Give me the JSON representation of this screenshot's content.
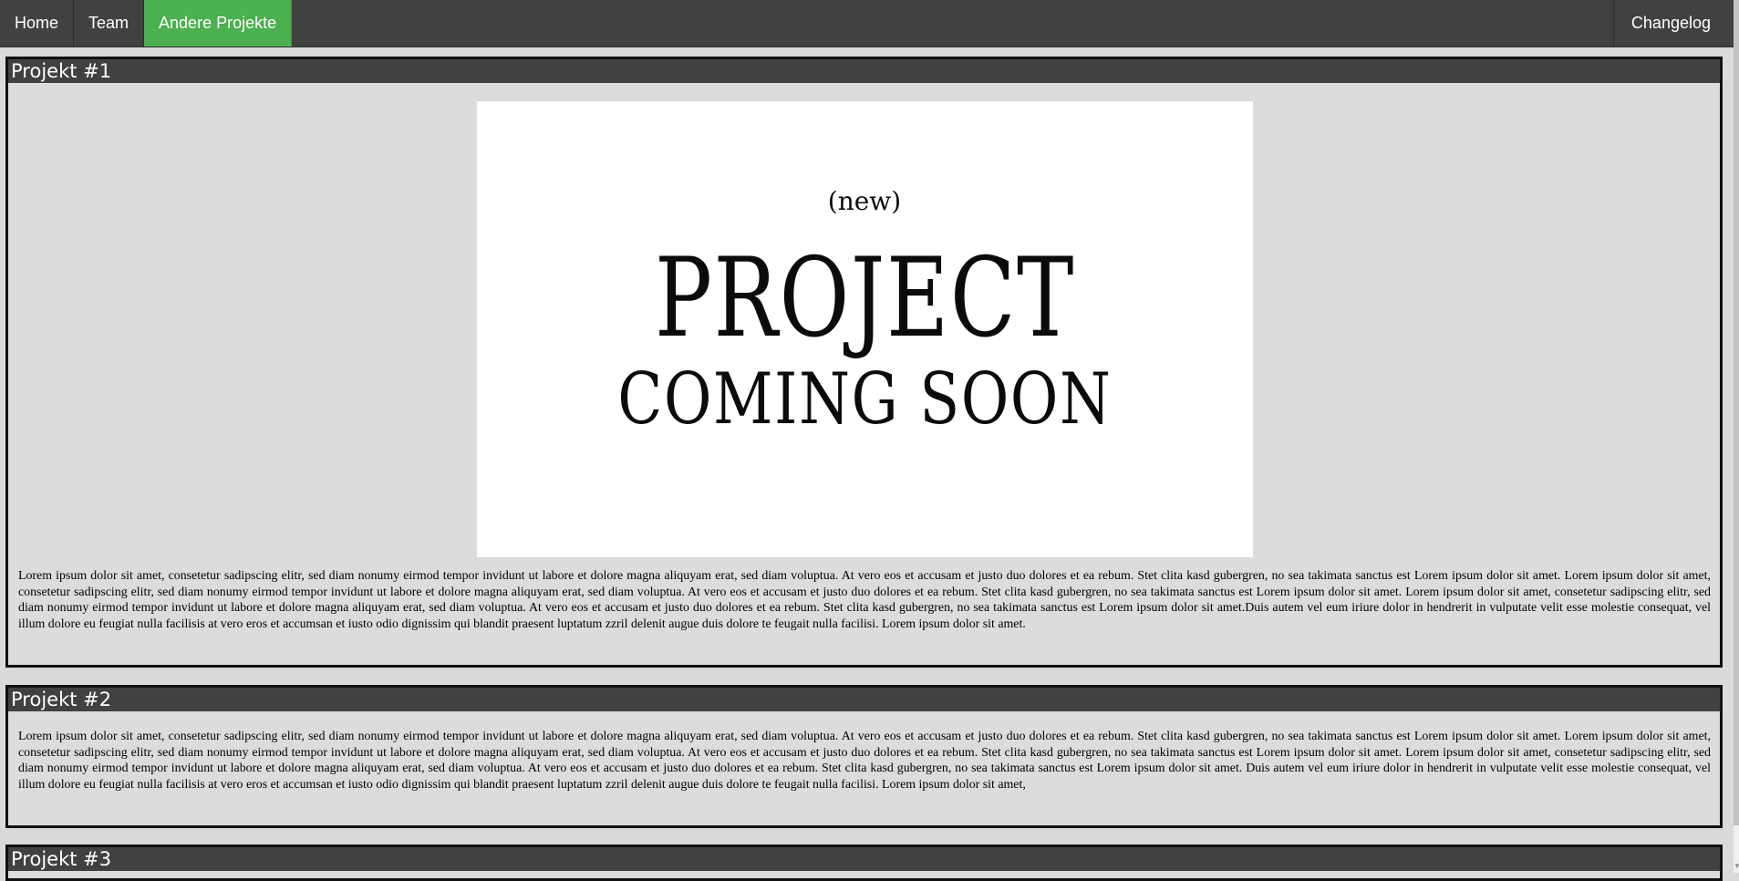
{
  "nav": {
    "home": "Home",
    "team": "Team",
    "other_projects": "Andere Projekte",
    "changelog": "Changelog",
    "active_color": "#4caf50",
    "bar_color": "#414141"
  },
  "projects": [
    {
      "title": "Projekt #1",
      "image": {
        "new": "(new)",
        "line1": "PROJECT",
        "line2": "COMING SOON"
      },
      "text": "Lorem ipsum dolor sit amet, consetetur sadipscing elitr, sed diam nonumy eirmod tempor invidunt ut labore et dolore magna aliquyam erat, sed diam voluptua. At vero eos et accusam et justo duo dolores et ea rebum. Stet clita kasd gubergren, no sea takimata sanctus est Lorem ipsum dolor sit amet. Lorem ipsum dolor sit amet, consetetur sadipscing elitr, sed diam nonumy eirmod tempor invidunt ut labore et dolore magna aliquyam erat, sed diam voluptua. At vero eos et accusam et justo duo dolores et ea rebum. Stet clita kasd gubergren, no sea takimata sanctus est Lorem ipsum dolor sit amet. Lorem ipsum dolor sit amet, consetetur sadipscing elitr, sed diam nonumy eirmod tempor invidunt ut labore et dolore magna aliquyam erat, sed diam voluptua. At vero eos et accusam et justo duo dolores et ea rebum. Stet clita kasd gubergren, no sea takimata sanctus est Lorem ipsum dolor sit amet.Duis autem vel eum iriure dolor in hendrerit in vulputate velit esse molestie consequat, vel illum dolore eu feugiat nulla facilisis at vero eros et accumsan et iusto odio dignissim qui blandit praesent luptatum zzril delenit augue duis dolore te feugait nulla facilisi. Lorem ipsum dolor sit amet."
    },
    {
      "title": "Projekt #2",
      "text": "Lorem ipsum dolor sit amet, consetetur sadipscing elitr, sed diam nonumy eirmod tempor invidunt ut labore et dolore magna aliquyam erat, sed diam voluptua. At vero eos et accusam et justo duo dolores et ea rebum. Stet clita kasd gubergren, no sea takimata sanctus est Lorem ipsum dolor sit amet. Lorem ipsum dolor sit amet, consetetur sadipscing elitr, sed diam nonumy eirmod tempor invidunt ut labore et dolore magna aliquyam erat, sed diam voluptua. At vero eos et accusam et justo duo dolores et ea rebum. Stet clita kasd gubergren, no sea takimata sanctus est Lorem ipsum dolor sit amet. Lorem ipsum dolor sit amet, consetetur sadipscing elitr, sed diam nonumy eirmod tempor invidunt ut labore et dolore magna aliquyam erat, sed diam voluptua. At vero eos et accusam et justo duo dolores et ea rebum. Stet clita kasd gubergren, no sea takimata sanctus est Lorem ipsum dolor sit amet. Duis autem vel eum iriure dolor in hendrerit in vulputate velit esse molestie consequat, vel illum dolore eu feugiat nulla facilisis at vero eros et accumsan et iusto odio dignissim qui blandit praesent luptatum zzril delenit augue duis dolore te feugait nulla facilisi. Lorem ipsum dolor sit amet,"
    },
    {
      "title": "Projekt #3"
    }
  ]
}
